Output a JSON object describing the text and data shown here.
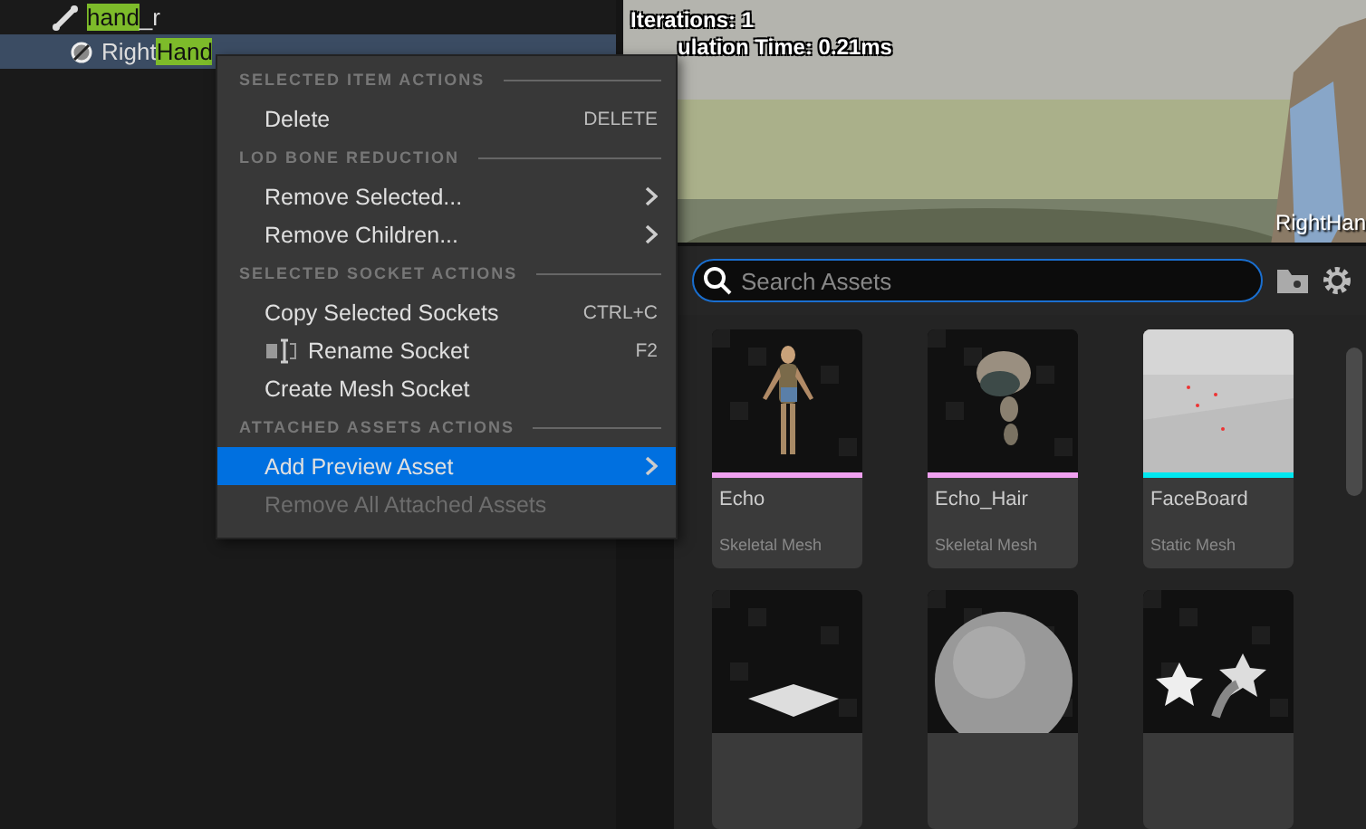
{
  "tree": [
    {
      "parts": [
        {
          "text": "hand",
          "match": true
        },
        {
          "text": "_r",
          "match": false
        }
      ],
      "selected": false
    },
    {
      "parts": [
        {
          "text": "Right",
          "match": false
        },
        {
          "text": "Hand",
          "match": true
        }
      ],
      "selected": true
    }
  ],
  "viewport": {
    "stats": [
      "Iterations: 1",
      "ulation Time: 0.21ms"
    ],
    "bone_label": "RightHan"
  },
  "context_menu": {
    "sections": [
      {
        "header": "SELECTED ITEM ACTIONS",
        "items": [
          {
            "label": "Delete",
            "shortcut": "DELETE",
            "kind": "item",
            "selected": false,
            "disabled": false
          }
        ]
      },
      {
        "header": "LOD BONE REDUCTION",
        "items": [
          {
            "label": "Remove Selected...",
            "kind": "submenu",
            "selected": false,
            "disabled": false
          },
          {
            "label": "Remove Children...",
            "kind": "submenu",
            "selected": false,
            "disabled": false
          }
        ]
      },
      {
        "header": "SELECTED SOCKET ACTIONS",
        "items": [
          {
            "label": "Copy Selected Sockets",
            "shortcut": "CTRL+C",
            "kind": "item",
            "selected": false,
            "disabled": false
          },
          {
            "label": "Rename Socket",
            "shortcut": "F2",
            "kind": "icon-item",
            "selected": false,
            "disabled": false
          },
          {
            "label": "Create Mesh Socket",
            "kind": "item",
            "selected": false,
            "disabled": false
          }
        ]
      },
      {
        "header": "ATTACHED ASSETS ACTIONS",
        "items": [
          {
            "label": "Add Preview Asset",
            "kind": "submenu",
            "selected": true,
            "disabled": false
          },
          {
            "label": "Remove All Attached Assets",
            "kind": "item",
            "selected": false,
            "disabled": true
          }
        ]
      }
    ]
  },
  "asset_picker": {
    "search": {
      "placeholder": "Search Assets"
    },
    "assets": [
      {
        "name": "Echo",
        "type": "Skeletal Mesh",
        "color": "#f0a0f0",
        "kind": "figure"
      },
      {
        "name": "Echo_Hair",
        "type": "Skeletal Mesh",
        "color": "#f0a0f0",
        "kind": "hair"
      },
      {
        "name": "FaceBoard",
        "type": "Static Mesh",
        "color": "#00e8f0",
        "kind": "plane"
      },
      {
        "kind": "cube"
      },
      {
        "kind": "sphere"
      },
      {
        "kind": "stars"
      }
    ]
  }
}
